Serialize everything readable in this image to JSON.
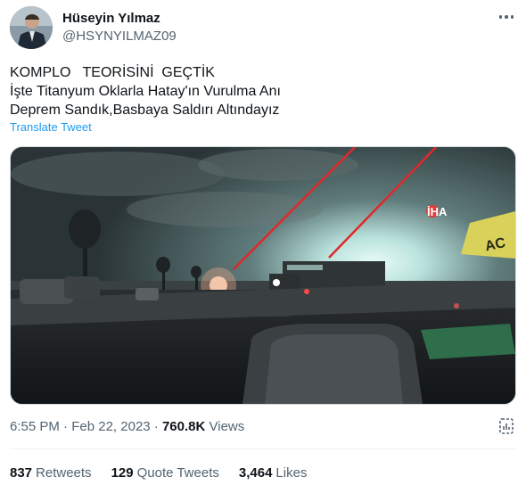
{
  "author": {
    "name": "Hüseyin Yılmaz",
    "handle": "@HSYNYILMAZ09"
  },
  "tweet": {
    "lines": [
      "KOMPLO   TEORİSİNİ  GEÇTİK",
      "İşte Titanyum Oklarla Hatay'ın Vurulma Anı",
      "Deprem Sandık,Basbaya Saldırı Altındayız"
    ],
    "translate_label": "Translate Tweet"
  },
  "media": {
    "watermark": "İHA",
    "sign_text": "AC"
  },
  "meta": {
    "time": "6:55 PM",
    "separator": " · ",
    "date": "Feb 22, 2023",
    "views_count": "760.8K",
    "views_label": "Views"
  },
  "stats": {
    "retweets_count": "837",
    "retweets_label": "Retweets",
    "quotes_count": "129",
    "quotes_label": "Quote Tweets",
    "likes_count": "3,464",
    "likes_label": "Likes"
  },
  "colors": {
    "link": "#1d9bf0",
    "text": "#0f1419",
    "muted": "#536471",
    "annotation_line": "#e0282a"
  }
}
